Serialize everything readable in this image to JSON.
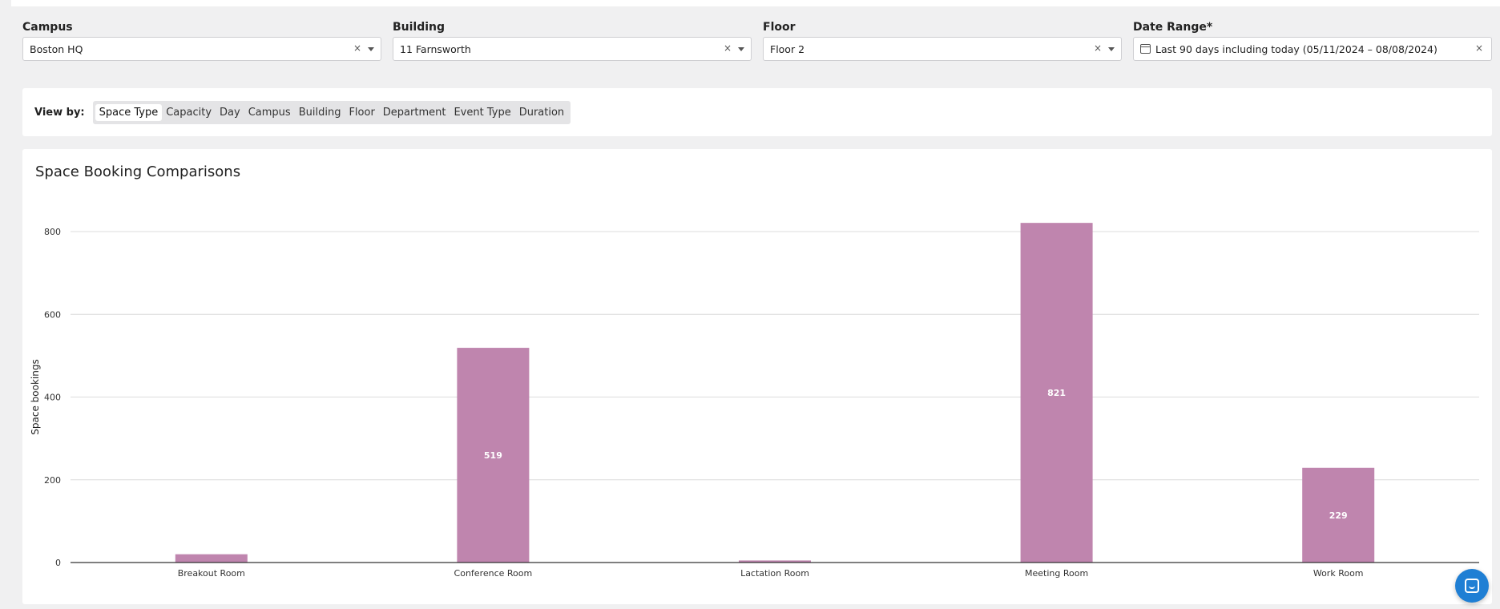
{
  "filters": {
    "campus": {
      "label": "Campus",
      "value": "Boston HQ",
      "clear": "×"
    },
    "building": {
      "label": "Building",
      "value": "11 Farnsworth",
      "clear": "×"
    },
    "floor": {
      "label": "Floor",
      "value": "Floor 2",
      "clear": "×"
    },
    "date_range": {
      "label": "Date Range",
      "required_mark": "*",
      "value": "Last 90 days including today (05/11/2024 – 08/08/2024)",
      "clear": "×"
    }
  },
  "viewby": {
    "label": "View by:",
    "tabs": [
      "Space Type",
      "Capacity",
      "Day",
      "Campus",
      "Building",
      "Floor",
      "Department",
      "Event Type",
      "Duration"
    ],
    "active_index": 0
  },
  "chart": {
    "title": "Space Booking Comparisons"
  },
  "chart_data": {
    "type": "bar",
    "title": "Space Booking Comparisons",
    "categories": [
      "Breakout Room",
      "Conference Room",
      "Lactation Room",
      "Meeting Room",
      "Work Room"
    ],
    "values": [
      20,
      519,
      5,
      821,
      229
    ],
    "data_labels": [
      "",
      "519",
      "",
      "821",
      "229"
    ],
    "ylabel": "Space bookings",
    "xlabel": "",
    "ylim": [
      0,
      800
    ],
    "yticks": [
      0,
      200,
      400,
      600,
      800
    ],
    "grid": true,
    "bar_color": "#bf85ae"
  },
  "colors": {
    "accent": "#1f7fd4",
    "bar": "#bf85ae"
  }
}
